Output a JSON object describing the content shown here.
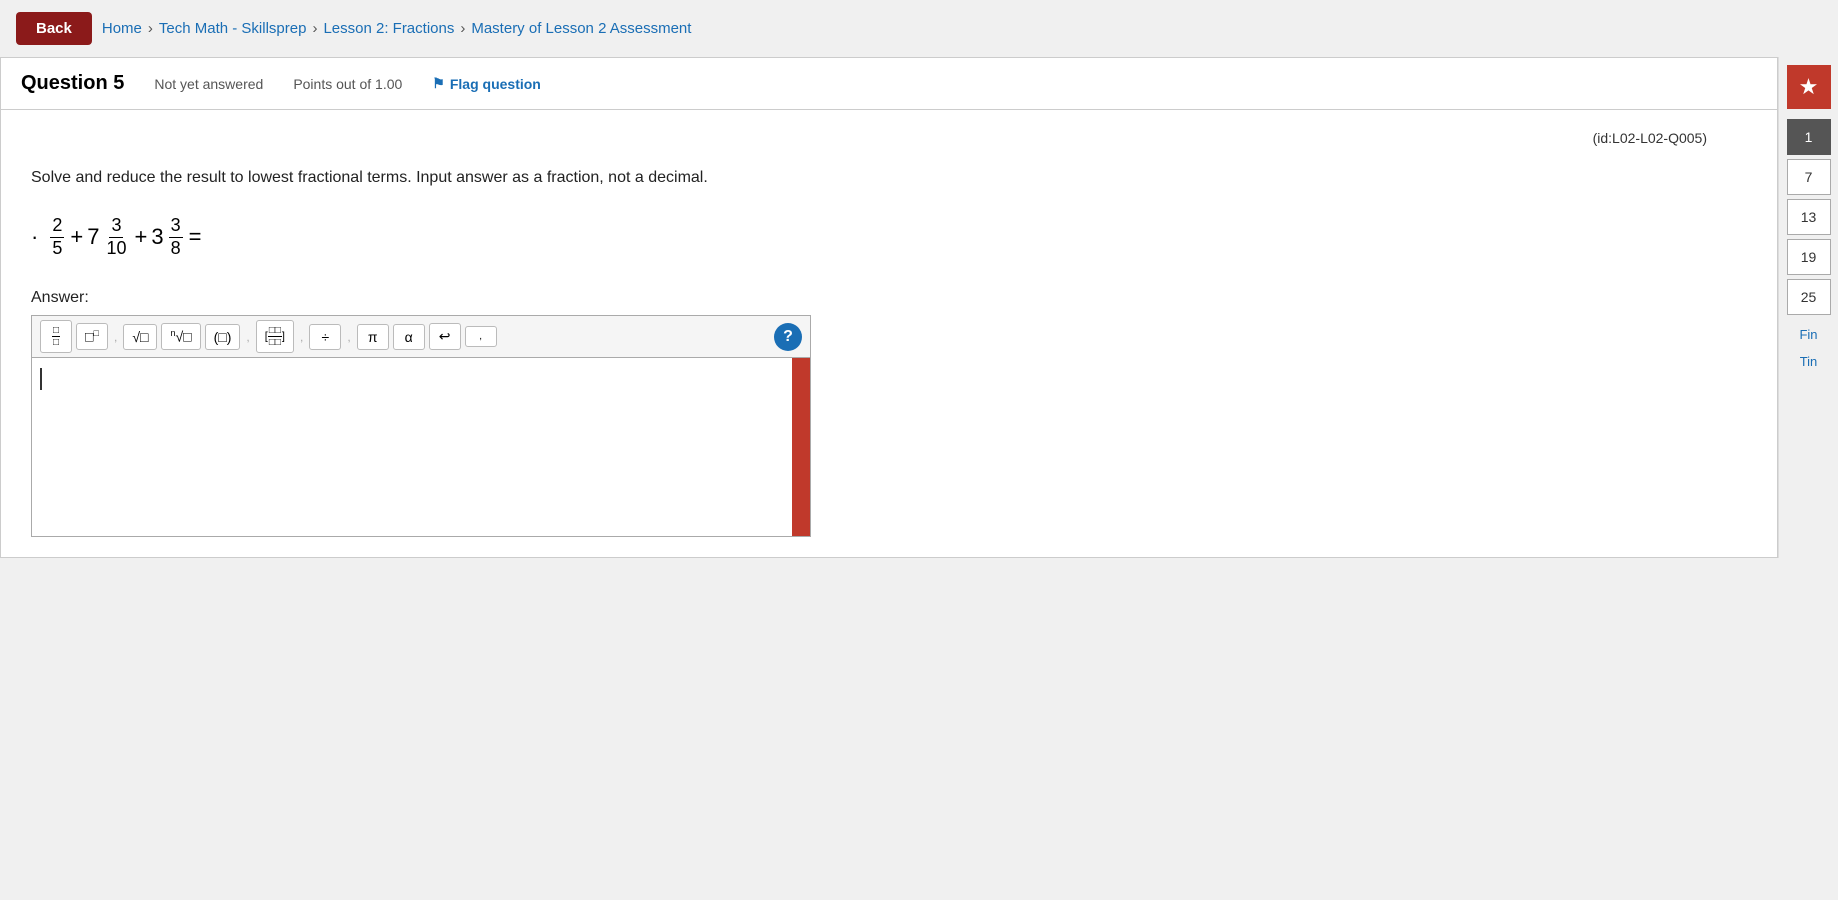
{
  "nav": {
    "back_label": "Back",
    "breadcrumb": [
      {
        "text": "Home",
        "separator": ">"
      },
      {
        "text": "Tech Math - Skillsprep",
        "separator": ">"
      },
      {
        "text": "Lesson 2: Fractions",
        "separator": ">"
      },
      {
        "text": "Mastery of Lesson 2 Assessment",
        "separator": ""
      }
    ]
  },
  "question": {
    "title": "Question 5",
    "status": "Not yet answered",
    "points": "Points out of 1.00",
    "flag_label": "Flag question",
    "id_label": "(id:L02-L02-Q005)",
    "instruction": "Solve and reduce the result to lowest fractional terms. Input answer as a fraction, not a decimal.",
    "expression": "· 2/5 + 7 3/10 + 3 3/8 =",
    "answer_label": "Answer:"
  },
  "toolbar": {
    "buttons": [
      {
        "label": "fraction",
        "symbol": "□/□"
      },
      {
        "label": "superscript",
        "symbol": "□²"
      },
      {
        "label": "sqrt",
        "symbol": "√□"
      },
      {
        "label": "nth-root",
        "symbol": "ⁿ√□"
      },
      {
        "label": "parentheses",
        "symbol": "(□)"
      },
      {
        "label": "matrix",
        "symbol": "[[□□]]"
      },
      {
        "label": "divide",
        "symbol": "÷"
      },
      {
        "label": "pi",
        "symbol": "π"
      },
      {
        "label": "alpha",
        "symbol": "α"
      },
      {
        "label": "undo",
        "symbol": "↩"
      },
      {
        "label": "redo",
        "symbol": "↪"
      },
      {
        "label": "help",
        "symbol": "?"
      }
    ]
  },
  "sidebar": {
    "star_label": "★",
    "questions": [
      {
        "number": "1",
        "active": true
      },
      {
        "number": "7",
        "active": false
      },
      {
        "number": "13",
        "active": false
      },
      {
        "number": "19",
        "active": false
      },
      {
        "number": "25",
        "active": false
      }
    ],
    "finish_label": "Fin",
    "timer_label": "Tin"
  }
}
